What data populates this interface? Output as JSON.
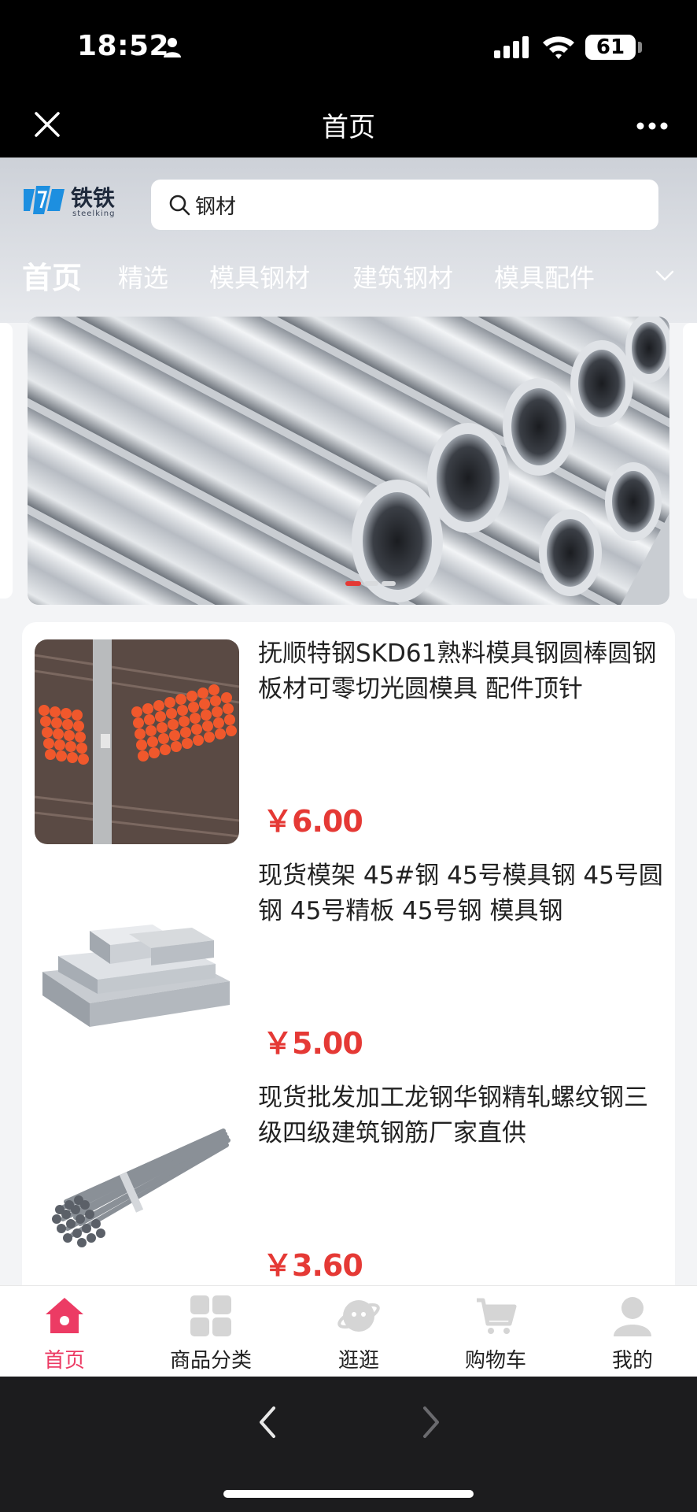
{
  "status_bar": {
    "time": "18:52",
    "battery": "61"
  },
  "title_bar": {
    "title": "首页"
  },
  "brand": {
    "name": "铁铁",
    "sub": "steelking"
  },
  "search": {
    "value": "钢材"
  },
  "category_tabs": [
    {
      "label": "首页",
      "active": true
    },
    {
      "label": "精选"
    },
    {
      "label": "模具钢材"
    },
    {
      "label": "建筑钢材"
    },
    {
      "label": "模具配件"
    }
  ],
  "products": [
    {
      "name": "抚顺特钢SKD61熟料模具钢圆棒圆钢板材可零切光圆模具 配件顶针",
      "price": "￥6.00"
    },
    {
      "name": "现货模架 45#钢 45号模具钢 45号圆钢 45号精板 45号钢 模具钢",
      "price": "￥5.00"
    },
    {
      "name": "现货批发加工龙钢华钢精轧螺纹钢三级四级建筑钢筋厂家直供",
      "price": "￥3.60"
    }
  ],
  "bottom_tabs": [
    {
      "label": "首页",
      "icon": "home-icon",
      "active": true
    },
    {
      "label": "商品分类",
      "icon": "category-grid-icon"
    },
    {
      "label": "逛逛",
      "icon": "planet-icon"
    },
    {
      "label": "购物车",
      "icon": "cart-icon"
    },
    {
      "label": "我的",
      "icon": "user-icon"
    }
  ],
  "colors": {
    "accent": "#ec3b64",
    "price": "#e53935"
  }
}
